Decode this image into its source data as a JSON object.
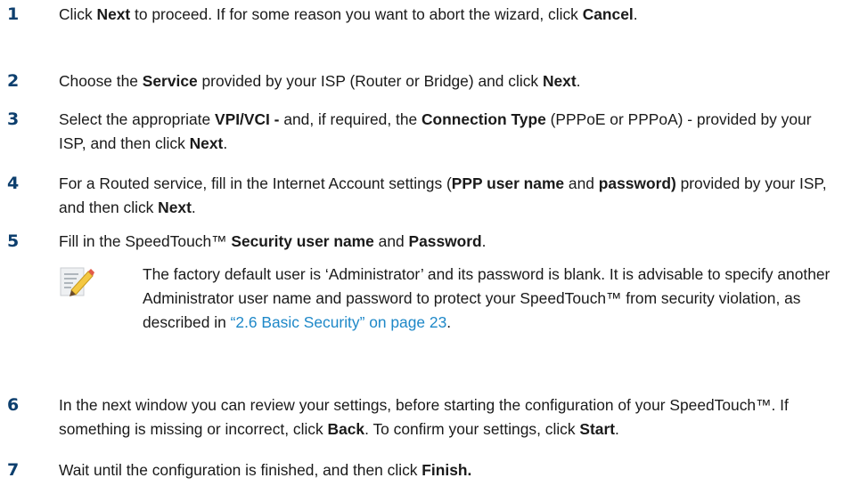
{
  "steps": [
    {
      "number": "1",
      "parts": [
        "Click ",
        "Next",
        " to proceed. If for some reason you want to abort the wizard, click ",
        "Cancel",
        "."
      ]
    },
    {
      "number": "2",
      "parts": [
        "Choose the ",
        "Service",
        " provided by your ISP (Router or Bridge) and click ",
        "Next",
        "."
      ]
    },
    {
      "number": "3",
      "parts": [
        "Select the appropriate ",
        "VPI/VCI -",
        " and, if required, the ",
        "Connection Type",
        " (PPPoE or PPPoA) - provided by your ISP, and then click ",
        "Next",
        "."
      ]
    },
    {
      "number": "4",
      "parts": [
        "For a Routed service, fill in the Internet Account settings (",
        "PPP user name",
        " and ",
        "password)",
        " provided by your ISP, and then click ",
        "Next",
        "."
      ]
    },
    {
      "number": "5",
      "parts": [
        "Fill in the SpeedTouch™ ",
        "Security user name",
        " and ",
        "Password",
        "."
      ]
    },
    {
      "number": "6",
      "parts": [
        "In the next window you can review your settings, before starting the configuration of your SpeedTouch™. If something is missing or incorrect, click ",
        "Back",
        ". To confirm your settings, click ",
        "Start",
        "."
      ]
    },
    {
      "number": "7",
      "parts": [
        "Wait until the configuration is finished, and then click ",
        "Finish.",
        ""
      ]
    }
  ],
  "note": {
    "icon": "note-pencil-icon",
    "text_before": "The factory default user is ‘Administrator’ and its password is blank. It is advisable to specify another Administrator user name and password to protect your SpeedTouch™ from security violation, as described in ",
    "link_text": "“2.6 Basic Security” on page 23",
    "text_after": "."
  },
  "colors": {
    "step_number": "#0d3f6e",
    "link": "#1e88c8",
    "text": "#1a1a1a"
  }
}
